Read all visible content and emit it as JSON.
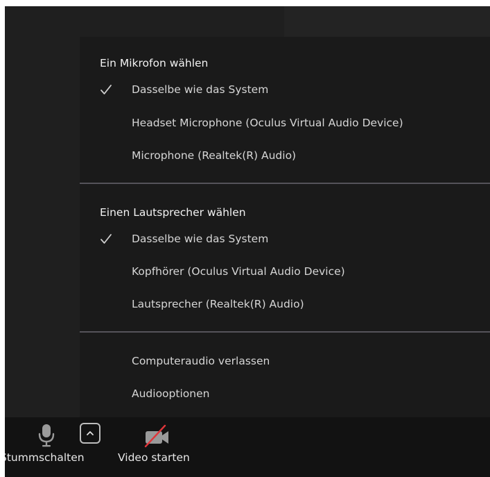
{
  "audio_menu": {
    "microphone_heading": "Ein Mikrofon wählen",
    "microphones": [
      {
        "label": "Dasselbe wie das System",
        "selected": true
      },
      {
        "label": "Headset Microphone (Oculus Virtual Audio Device)",
        "selected": false
      },
      {
        "label": "Microphone (Realtek(R) Audio)",
        "selected": false
      }
    ],
    "speaker_heading": "Einen Lautsprecher wählen",
    "speakers": [
      {
        "label": "Dasselbe wie das System",
        "selected": true
      },
      {
        "label": "Kopfhörer (Oculus Virtual Audio Device)",
        "selected": false
      },
      {
        "label": "Lautsprecher (Realtek(R) Audio)",
        "selected": false
      }
    ],
    "actions": [
      {
        "label": "Computeraudio verlassen"
      },
      {
        "label": "Audiooptionen"
      }
    ]
  },
  "toolbar": {
    "mute_label": "Stummschalten",
    "video_label": "Video starten",
    "mic_icon": "microphone-icon",
    "chevron_icon": "chevron-up-icon",
    "video_icon": "video-camera-off-icon"
  },
  "colors": {
    "window_bg": "#1f1f1f",
    "menu_bg": "#1a1a1a",
    "toolbar_bg": "#121212",
    "divider": "#55535a",
    "video_off_slash": "#e0353a"
  }
}
